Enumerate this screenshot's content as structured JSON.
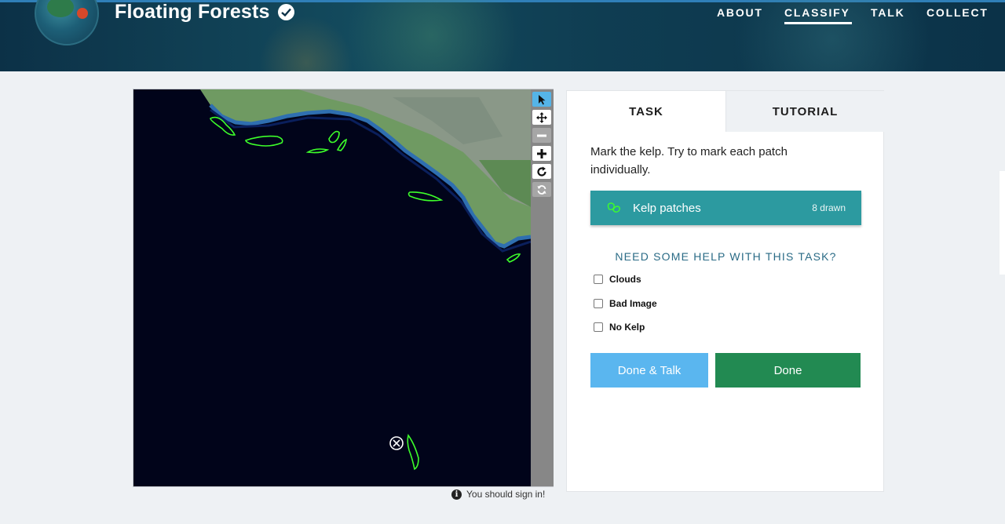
{
  "header": {
    "brand": "Floating Forests",
    "nav": [
      {
        "label": "ABOUT",
        "active": false
      },
      {
        "label": "CLASSIFY",
        "active": true
      },
      {
        "label": "TALK",
        "active": false
      },
      {
        "label": "COLLECT",
        "active": false
      }
    ]
  },
  "viewer": {
    "tools": [
      "pointer-icon",
      "pan-icon",
      "zoom-out-icon",
      "zoom-in-icon",
      "rotate-icon",
      "reset-icon"
    ],
    "signin_notice": "You should sign in!"
  },
  "panel": {
    "tabs": {
      "task": "TASK",
      "tutorial": "TUTORIAL"
    },
    "instruction": "Mark the kelp. Try to mark each patch individually.",
    "tool": {
      "label": "Kelp patches",
      "count": "8 drawn",
      "color": "#2c9aa0"
    },
    "help_title": "NEED SOME HELP WITH THIS TASK?",
    "checkboxes": [
      "Clouds",
      "Bad Image",
      "No Kelp"
    ],
    "buttons": {
      "talk": "Done & Talk",
      "done": "Done"
    }
  },
  "colors": {
    "accent": "#2c9aa0",
    "kelp_outline": "#3dff2a",
    "done_green": "#228a52",
    "talk_blue": "#5ab6ef"
  }
}
